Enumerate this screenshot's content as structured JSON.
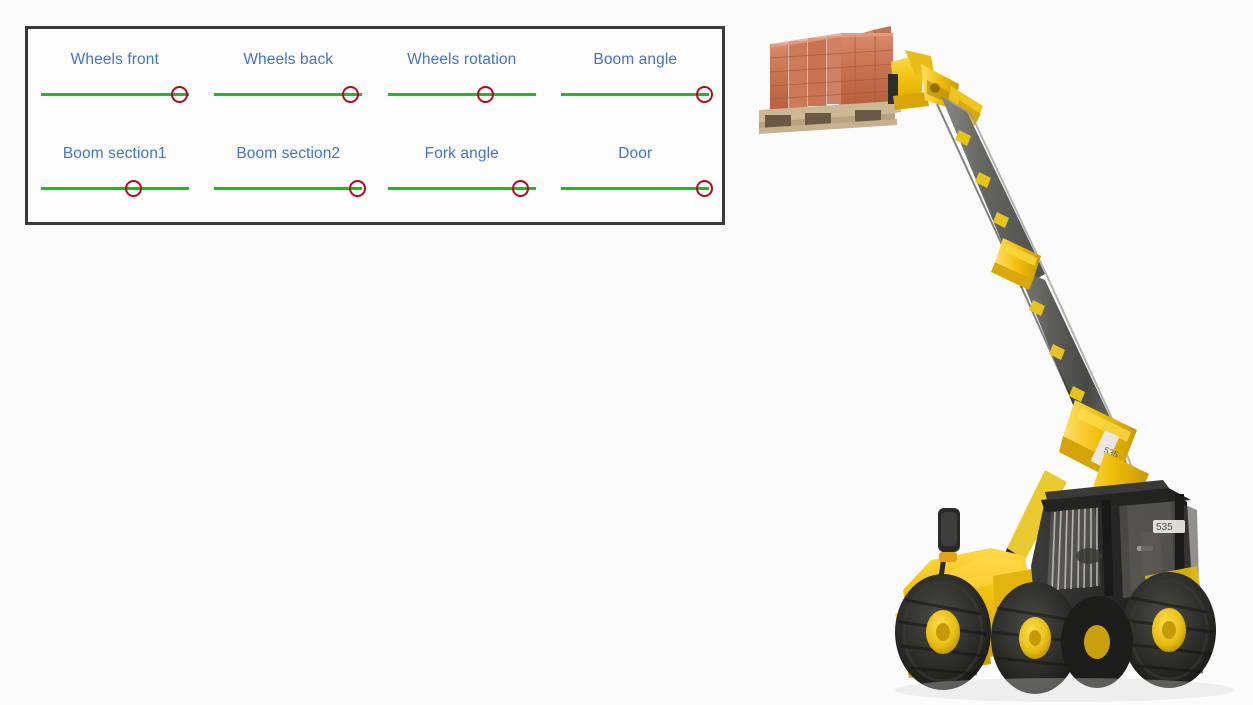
{
  "app": {
    "background_color": "#fbfbfb"
  },
  "control_panel": {
    "name": "telehandler-control-panel",
    "border_color": "#3a3a3a",
    "background_color": "#fdfdfd",
    "label_color": "#4473c5",
    "track_color": "#19c019",
    "knob_color": "#b00b1e",
    "rows": [
      {
        "sliders": [
          {
            "label": "Wheels front",
            "value_pct": 94
          },
          {
            "label": "Wheels back",
            "value_pct": 92
          },
          {
            "label": "Wheels rotation",
            "value_pct": 66
          },
          {
            "label": "Boom angle",
            "value_pct": 97
          }
        ]
      },
      {
        "sliders": [
          {
            "label": "Boom section1",
            "value_pct": 63
          },
          {
            "label": "Boom section2",
            "value_pct": 97
          },
          {
            "label": "Fork angle",
            "value_pct": 90
          },
          {
            "label": "Door",
            "value_pct": 97
          }
        ]
      }
    ]
  },
  "scene": {
    "name": "telehandler-with-brick-pallet",
    "description": "Yellow telehandler with extended dark telescopic boom lifting a wooden pallet stacked with red clay bricks",
    "machine_body_color": "#f0c000",
    "machine_accent_color": "#e0a800",
    "cab_color": "#2b2b2b",
    "boom_color": "#5b5b58",
    "tire_color": "#2a2a28",
    "wheel_hub_color": "#e8c21a",
    "brick_color": "#cb7056",
    "pallet_color": "#c9b392"
  }
}
